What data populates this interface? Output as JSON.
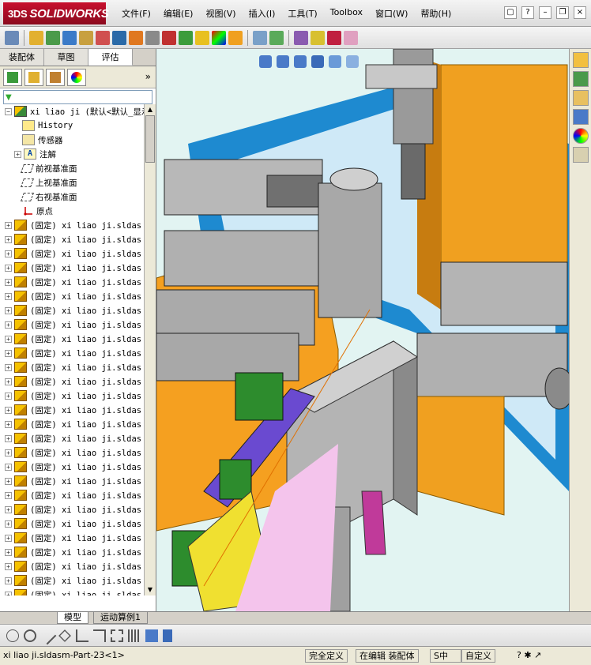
{
  "app": {
    "brand": "SOLIDWORKS",
    "brand_prefix": "3DS"
  },
  "menu": [
    "文件(F)",
    "编辑(E)",
    "视图(V)",
    "插入(I)",
    "工具(T)",
    "Toolbox",
    "窗口(W)",
    "帮助(H)"
  ],
  "panel": {
    "tabs": [
      "装配体",
      "草图",
      "评估"
    ],
    "active_tab": "评估",
    "more": "»",
    "filter_icon": "filter-icon"
  },
  "tree": {
    "root": "xi liao ji  (默认<默认_显示",
    "fixed": [
      {
        "label": "History",
        "icon": "history-icon"
      },
      {
        "label": "传感器",
        "icon": "sensor-icon"
      },
      {
        "label": "注解",
        "icon": "annotation-icon"
      },
      {
        "label": "前视基准面",
        "icon": "plane-icon"
      },
      {
        "label": "上视基准面",
        "icon": "plane-icon"
      },
      {
        "label": "右视基准面",
        "icon": "plane-icon"
      },
      {
        "label": "原点",
        "icon": "origin-icon"
      }
    ],
    "component_label": "(固定) xi liao ji.sldas",
    "component_count": 27
  },
  "bottom_tabs": [
    "模型",
    "运动算例1"
  ],
  "status": {
    "path": "xi liao ji.sldasm-Part-23<1>",
    "define": "完全定义",
    "mode": "在编辑 装配体",
    "units": "自定义"
  },
  "colors": {
    "accent": "#c8102e",
    "frame_blue": "#1e90d8",
    "machine_gray": "#b4b4b4",
    "orange": "#f5a020",
    "green": "#2d8c2d",
    "purple": "#6a3fc0"
  }
}
